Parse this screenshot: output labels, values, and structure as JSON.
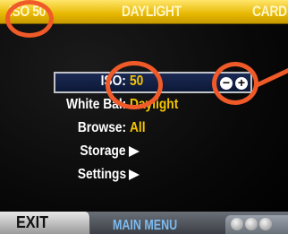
{
  "status_bar": {
    "iso": "ISO 50",
    "white_balance_mode": "DAYLIGHT",
    "storage": "CARD"
  },
  "menu": {
    "rows": [
      {
        "label": "ISO:",
        "value": "50",
        "selected": true
      },
      {
        "label": "White Bal:",
        "value": "Daylight"
      },
      {
        "label": "Browse:",
        "value": "All"
      },
      {
        "label": "Storage",
        "submenu": true
      },
      {
        "label": "Settings",
        "submenu": true
      }
    ],
    "adjust_icons": [
      "minus-icon",
      "plus-icon"
    ]
  },
  "footer": {
    "exit_label": "EXIT",
    "title": "MAIN MENU",
    "nav_icon": "three-dots-icon"
  },
  "colors": {
    "topbar": "#f0c000",
    "value_text": "#f5c400",
    "highlight": "#142448",
    "annotation": "#f05a28"
  }
}
